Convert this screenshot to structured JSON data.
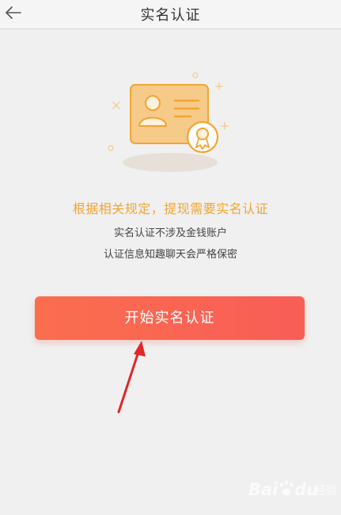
{
  "header": {
    "title": "实名认证",
    "back_icon": "arrow-left-icon"
  },
  "illustration": {
    "icon": "id-card-icon",
    "accent": "#f2a531"
  },
  "notice": {
    "text": "根据相关规定，提现需要实名认证"
  },
  "descriptions": [
    "实名认证不涉及金钱账户",
    "认证信息知趣聊天会严格保密"
  ],
  "actions": {
    "start_label": "开始实名认证"
  },
  "colors": {
    "background": "#f0f0f0",
    "notice": "#f2a531",
    "button_start": "#fa6e4f",
    "button_end": "#f95d56",
    "annotation_arrow": "#e02828"
  }
}
